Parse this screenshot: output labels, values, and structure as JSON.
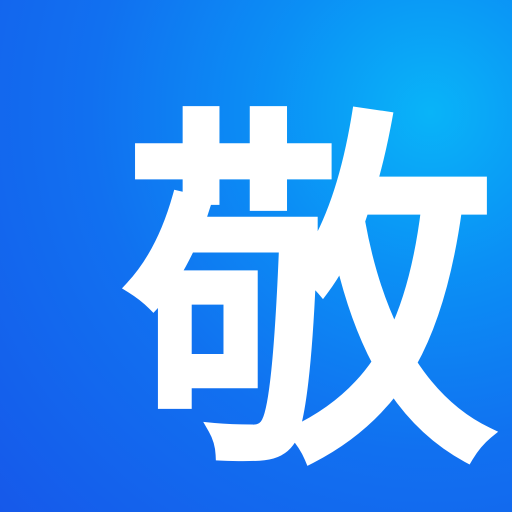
{
  "icon": {
    "character": "敬",
    "glyph_color": "#ffffff",
    "background_colors": [
      "#09b4f8",
      "#0b8ff5",
      "#1170f0",
      "#1659ea"
    ]
  }
}
